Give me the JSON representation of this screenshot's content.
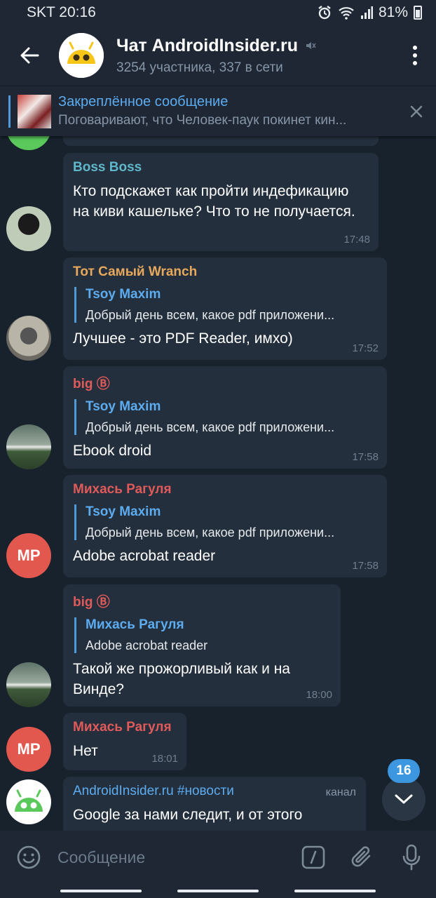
{
  "status_bar": {
    "carrier_time": "SKT 20:16",
    "battery": "81%",
    "icons": [
      "alarm-icon",
      "wifi-icon",
      "signal-icon",
      "battery-icon"
    ]
  },
  "header": {
    "title": "Чат AndroidInsider.ru",
    "subtitle": "3254 участника, 337 в сети",
    "muted": true
  },
  "pinned": {
    "title": "Закреплённое сообщение",
    "preview": "Поговаривают, что Человек-паук покинет кин..."
  },
  "messages": [
    {
      "sender": "Boss Boss",
      "sender_color": "#5fb8c9",
      "text": "Кто  подскажет как пройти индефикацию на киви кашельке? Что то не получается.",
      "time": "17:48",
      "avatar": "photo"
    },
    {
      "sender": "Тот Самый Wranch",
      "sender_color": "#e8a85c",
      "reply_name": "Tsoy Maxim",
      "reply_text": "Добрый день всем, какое pdf приложени...",
      "text": "Лучшее - это PDF Reader, имхо)",
      "time": "17:52",
      "avatar": "photo"
    },
    {
      "sender": "big Ⓑ",
      "sender_color": "#e05a5a",
      "reply_name": "Tsoy Maxim",
      "reply_text": "Добрый день всем, какое pdf приложени...",
      "text": "Ebook droid",
      "time": "17:58",
      "avatar": "photo"
    },
    {
      "sender": "Михась Рагуля",
      "sender_color": "#e05a5a",
      "reply_name": "Tsoy Maxim",
      "reply_text": "Добрый день всем, какое pdf приложени...",
      "text": "Adobe acrobat reader",
      "time": "17:58",
      "avatar": "initials",
      "initials": "MP"
    },
    {
      "sender": "big Ⓑ",
      "sender_color": "#e05a5a",
      "reply_name": "Михась Рагуля",
      "reply_text": "Adobe acrobat reader",
      "text": "Такой же прожорливый как и на Винде?",
      "time": "18:00",
      "avatar": "photo"
    },
    {
      "sender": "Михась Рагуля",
      "sender_color": "#e05a5a",
      "text": "Нет",
      "time": "18:01",
      "avatar": "initials",
      "initials": "MP"
    },
    {
      "sender": "AndroidInsider.ru #новости",
      "sender_color": "#5cacef",
      "channel_tag": "канал",
      "text": "Google за нами следит, и от этого",
      "avatar": "logo"
    }
  ],
  "scroll_down": {
    "unread_count": "16"
  },
  "composer": {
    "placeholder": "Сообщение"
  },
  "colors": {
    "background": "#18222d",
    "bubble": "#242f3d",
    "header": "#1e2733",
    "accent": "#5cacef",
    "initials_avatar": "#e2584f",
    "logo_green": "#5ac85a"
  }
}
